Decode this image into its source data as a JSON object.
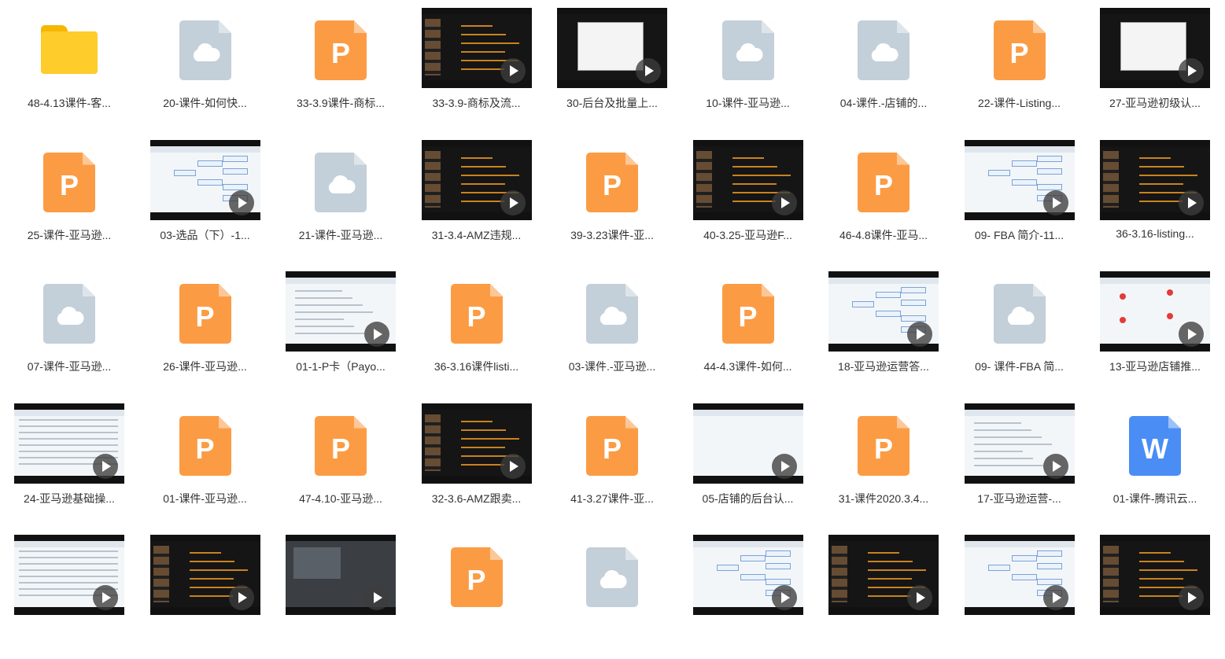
{
  "grid": {
    "items": [
      {
        "type": "folder",
        "label": "48-4.13课件-客..."
      },
      {
        "type": "cloud",
        "label": "20-课件-如何快..."
      },
      {
        "type": "ppt",
        "label": "33-3.9课件-商标..."
      },
      {
        "type": "video",
        "scene": "dark-slides",
        "label": "33-3.9-商标及流..."
      },
      {
        "type": "video",
        "scene": "dark-form",
        "label": "30-后台及批量上..."
      },
      {
        "type": "cloud",
        "label": "10-课件-亚马逊..."
      },
      {
        "type": "cloud",
        "label": "04-课件.-店铺的..."
      },
      {
        "type": "ppt",
        "label": "22-课件-Listing..."
      },
      {
        "type": "video",
        "scene": "dark-form",
        "label": "27-亚马逊初级认..."
      },
      {
        "type": "ppt",
        "label": "25-课件-亚马逊..."
      },
      {
        "type": "video",
        "scene": "light-mind",
        "label": "03-选品（下）-1..."
      },
      {
        "type": "cloud",
        "label": "21-课件-亚马逊..."
      },
      {
        "type": "video",
        "scene": "dark-title",
        "label": "31-3.4-AMZ违规..."
      },
      {
        "type": "ppt",
        "label": "39-3.23课件-亚..."
      },
      {
        "type": "video",
        "scene": "dark-slides",
        "label": "40-3.25-亚马逊F..."
      },
      {
        "type": "ppt",
        "label": "46-4.8课件-亚马..."
      },
      {
        "type": "video",
        "scene": "light-mind",
        "label": "09- FBA 简介-11..."
      },
      {
        "type": "video",
        "scene": "dark-slides",
        "label": "36-3.16-listing..."
      },
      {
        "type": "cloud",
        "label": "07-课件-亚马逊..."
      },
      {
        "type": "ppt",
        "label": "26-课件-亚马逊..."
      },
      {
        "type": "video",
        "scene": "light-web",
        "label": "01-1-P卡（Payo..."
      },
      {
        "type": "ppt",
        "label": "36-3.16课件listi..."
      },
      {
        "type": "cloud",
        "label": "03-课件.-亚马逊..."
      },
      {
        "type": "ppt",
        "label": "44-4.3课件-如何..."
      },
      {
        "type": "video",
        "scene": "light-mind",
        "label": "18-亚马逊运营答..."
      },
      {
        "type": "cloud",
        "label": "09- 课件-FBA 简..."
      },
      {
        "type": "video",
        "scene": "light-red",
        "label": "13-亚马逊店铺推..."
      },
      {
        "type": "video",
        "scene": "light-table",
        "label": "24-亚马逊基础操..."
      },
      {
        "type": "ppt",
        "label": "01-课件-亚马逊..."
      },
      {
        "type": "ppt",
        "label": "47-4.10-亚马逊..."
      },
      {
        "type": "video",
        "scene": "dark-slides",
        "label": "32-3.6-AMZ跟卖..."
      },
      {
        "type": "ppt",
        "label": "41-3.27课件-亚..."
      },
      {
        "type": "video",
        "scene": "light-blank",
        "label": "05-店铺的后台认..."
      },
      {
        "type": "ppt",
        "label": "31-课件2020.3.4..."
      },
      {
        "type": "video",
        "scene": "light-web",
        "label": "17-亚马逊运营-..."
      },
      {
        "type": "word",
        "label": "01-课件-腾讯云..."
      },
      {
        "type": "video",
        "scene": "light-table",
        "label": ""
      },
      {
        "type": "video",
        "scene": "dark-slides",
        "label": ""
      },
      {
        "type": "video",
        "scene": "dark-code",
        "label": ""
      },
      {
        "type": "ppt",
        "label": ""
      },
      {
        "type": "cloud",
        "label": ""
      },
      {
        "type": "video",
        "scene": "light-mind",
        "label": ""
      },
      {
        "type": "video",
        "scene": "dark-slides",
        "label": ""
      },
      {
        "type": "video",
        "scene": "light-mind",
        "label": ""
      },
      {
        "type": "video",
        "scene": "dark-slides",
        "label": ""
      }
    ],
    "glyphs": {
      "ppt": "P",
      "word": "W"
    }
  }
}
